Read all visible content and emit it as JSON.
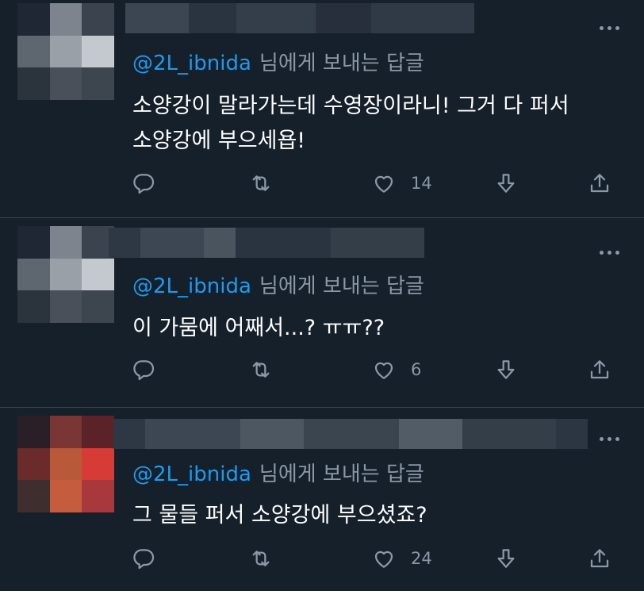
{
  "icons": {
    "reply": "speech-bubble-icon",
    "retweet": "retweet-icon",
    "like": "heart-icon",
    "downvote": "down-arrow-icon",
    "share": "share-icon",
    "more": "more-horizontal-icon"
  },
  "colors": {
    "background": "#15202b",
    "handle": "#1d9bf0",
    "muted": "#8b98a5",
    "divider": "#38444d",
    "text": "#ffffff"
  },
  "tweets": [
    {
      "reply_handle": "@2L_ibnida",
      "reply_suffix": "님에게 보내는 답글",
      "lines": [
        "소양강이 말라가는데 수영장이라니! 그거 다 퍼서",
        "소양강에 부으세욥!"
      ],
      "like_count": "14"
    },
    {
      "reply_handle": "@2L_ibnida",
      "reply_suffix": "님에게 보내는 답글",
      "lines": [
        "이 가뭄에 어째서...? ㅠㅠ??"
      ],
      "like_count": "6"
    },
    {
      "reply_handle": "@2L_ibnida",
      "reply_suffix": "님에게 보내는 답글",
      "lines": [
        "그 물들 퍼서 소양강에 부으셨죠?"
      ],
      "like_count": "24"
    }
  ]
}
